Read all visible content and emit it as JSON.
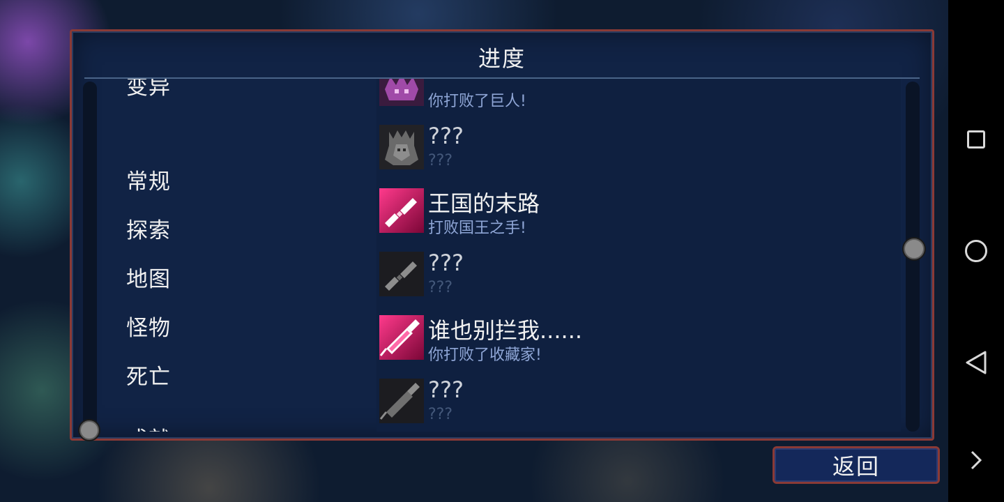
{
  "title": "进度",
  "categories": [
    {
      "label": "变异",
      "active": false
    },
    {
      "label": "常规",
      "active": false
    },
    {
      "label": "探索",
      "active": false
    },
    {
      "label": "地图",
      "active": false
    },
    {
      "label": "怪物",
      "active": false
    },
    {
      "label": "死亡",
      "active": false
    },
    {
      "label": "成就",
      "active": true
    }
  ],
  "achievements": [
    {
      "name": "",
      "desc": "你打败了巨人!",
      "locked": false,
      "icon": "giant-boss-icon"
    },
    {
      "name": "???",
      "desc": "???",
      "locked": true,
      "icon": "crowned-boss-icon"
    },
    {
      "name": "王国的末路",
      "desc": "打败国王之手!",
      "locked": false,
      "icon": "hand-of-king-icon"
    },
    {
      "name": "???",
      "desc": "???",
      "locked": true,
      "icon": "blade-icon"
    },
    {
      "name": "谁也别拦我......",
      "desc": "你打败了收藏家!",
      "locked": false,
      "icon": "collector-syringe-icon"
    },
    {
      "name": "???",
      "desc": "???",
      "locked": true,
      "icon": "syringe-icon"
    }
  ],
  "back_label": "返回",
  "colors": {
    "panel_bg": "#112345",
    "panel_border": "#8a3a36",
    "active_tab": "#2a9bd4",
    "achievement_accent": "#e0156e",
    "desc_text": "#8fa6d6"
  },
  "system_nav": [
    "recent-apps-icon",
    "home-icon",
    "back-icon",
    "expand-icon"
  ]
}
